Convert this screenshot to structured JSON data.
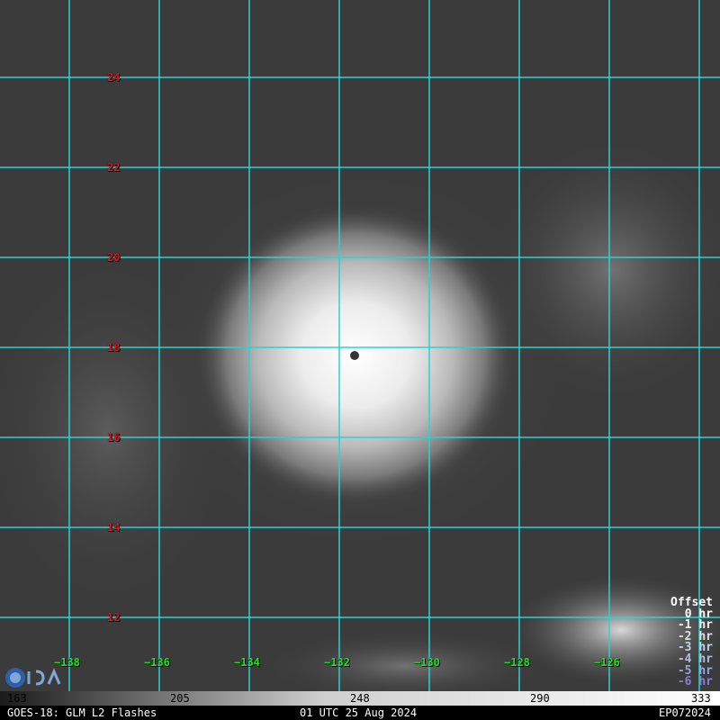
{
  "map": {
    "lat_labels": [
      "24",
      "22",
      "20",
      "18",
      "16",
      "14",
      "12"
    ],
    "lon_labels": [
      "−138",
      "−136",
      "−134",
      "−132",
      "−130",
      "−128",
      "−126"
    ],
    "grid_color": "#27d3d6",
    "lat_label_color": "#e8101a",
    "lon_label_color": "#1ee81e"
  },
  "offset_legend": {
    "title": "Offset",
    "items": [
      {
        "label": "0 hr",
        "color": "#ffffff"
      },
      {
        "label": "-1 hr",
        "color": "#f2f2f2"
      },
      {
        "label": "-2 hr",
        "color": "#e0e0e0"
      },
      {
        "label": "-3 hr",
        "color": "#c9d0e6"
      },
      {
        "label": "-4 hr",
        "color": "#b3bde0"
      },
      {
        "label": "-5 hr",
        "color": "#9aa6d6"
      },
      {
        "label": "-6 hr",
        "color": "#8a80c8"
      }
    ]
  },
  "colorbar": {
    "ticks": [
      "163",
      "205",
      "248",
      "290",
      "333"
    ]
  },
  "footer": {
    "left": "GOES-18: GLM L2 Flashes",
    "center": "01 UTC 25 Aug 2024",
    "right": "EP072024"
  },
  "logo": {
    "icon": "cira-logo-icon"
  }
}
